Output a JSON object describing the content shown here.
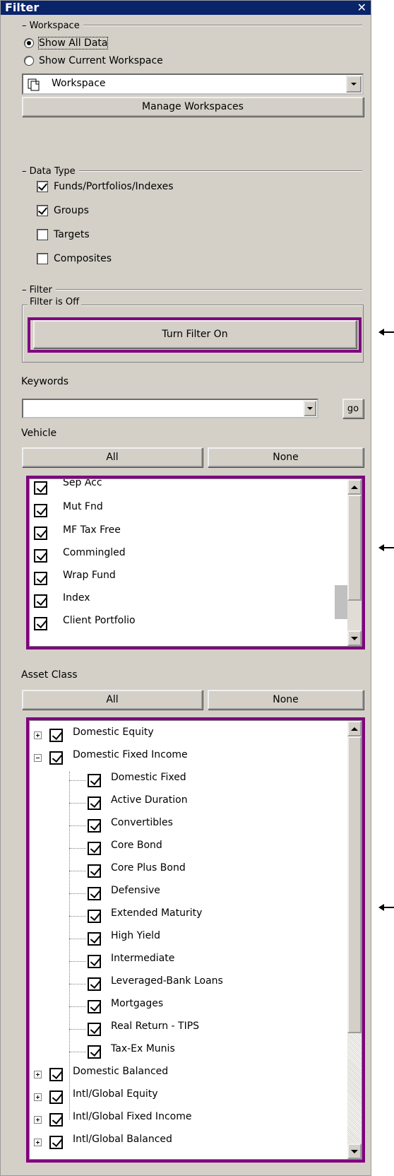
{
  "panel": {
    "title": "Filter",
    "close_glyph": "✕"
  },
  "workspace": {
    "legend": "Workspace",
    "show_all": "Show All Data",
    "show_current": "Show Current Workspace",
    "selected_value": "Workspace",
    "manage_button": "Manage Workspaces"
  },
  "data_type": {
    "legend": "Data Type",
    "items": [
      {
        "label": "Funds/Portfolios/Indexes",
        "checked": true
      },
      {
        "label": "Groups",
        "checked": true
      },
      {
        "label": "Targets",
        "checked": false
      },
      {
        "label": "Composites",
        "checked": false
      }
    ]
  },
  "filter": {
    "legend": "Filter",
    "status": "Filter is Off",
    "toggle_button": "Turn Filter On"
  },
  "keywords": {
    "label": "Keywords",
    "value": "",
    "go_button": "go"
  },
  "vehicle": {
    "label": "Vehicle",
    "all_button": "All",
    "none_button": "None",
    "items": [
      "Sep Acc",
      "Mut Fnd",
      "MF Tax Free",
      "Commingled",
      "Wrap Fund",
      "Index",
      "Client Portfolio"
    ]
  },
  "asset_class": {
    "label": "Asset Class",
    "all_button": "All",
    "none_button": "None",
    "top_a": [
      {
        "label": "Domestic Equity",
        "expander": "+"
      },
      {
        "label": "Domestic Fixed Income",
        "expander": "-"
      }
    ],
    "children": [
      "Domestic Fixed",
      "Active Duration",
      "Convertibles",
      "Core Bond",
      "Core Plus Bond",
      "Defensive",
      "Extended Maturity",
      "High Yield",
      "Intermediate",
      "Leveraged-Bank Loans",
      "Mortgages",
      "Real Return - TIPS",
      "Tax-Ex Munis"
    ],
    "top_b": [
      {
        "label": "Domestic Balanced",
        "expander": "+"
      },
      {
        "label": "Intl/Global Equity",
        "expander": "+"
      },
      {
        "label": "Intl/Global Fixed Income",
        "expander": "+"
      },
      {
        "label": "Intl/Global Balanced",
        "expander": "+"
      }
    ]
  },
  "colors": {
    "title_bar": "#0a246a",
    "panel_bg": "#d4d0c8",
    "highlight": "#800080"
  },
  "icons": {
    "workspace": "workspace-pages-icon",
    "close": "close-icon",
    "dropdown": "chevron-down-icon",
    "pointer": "arrow-left-icon"
  }
}
